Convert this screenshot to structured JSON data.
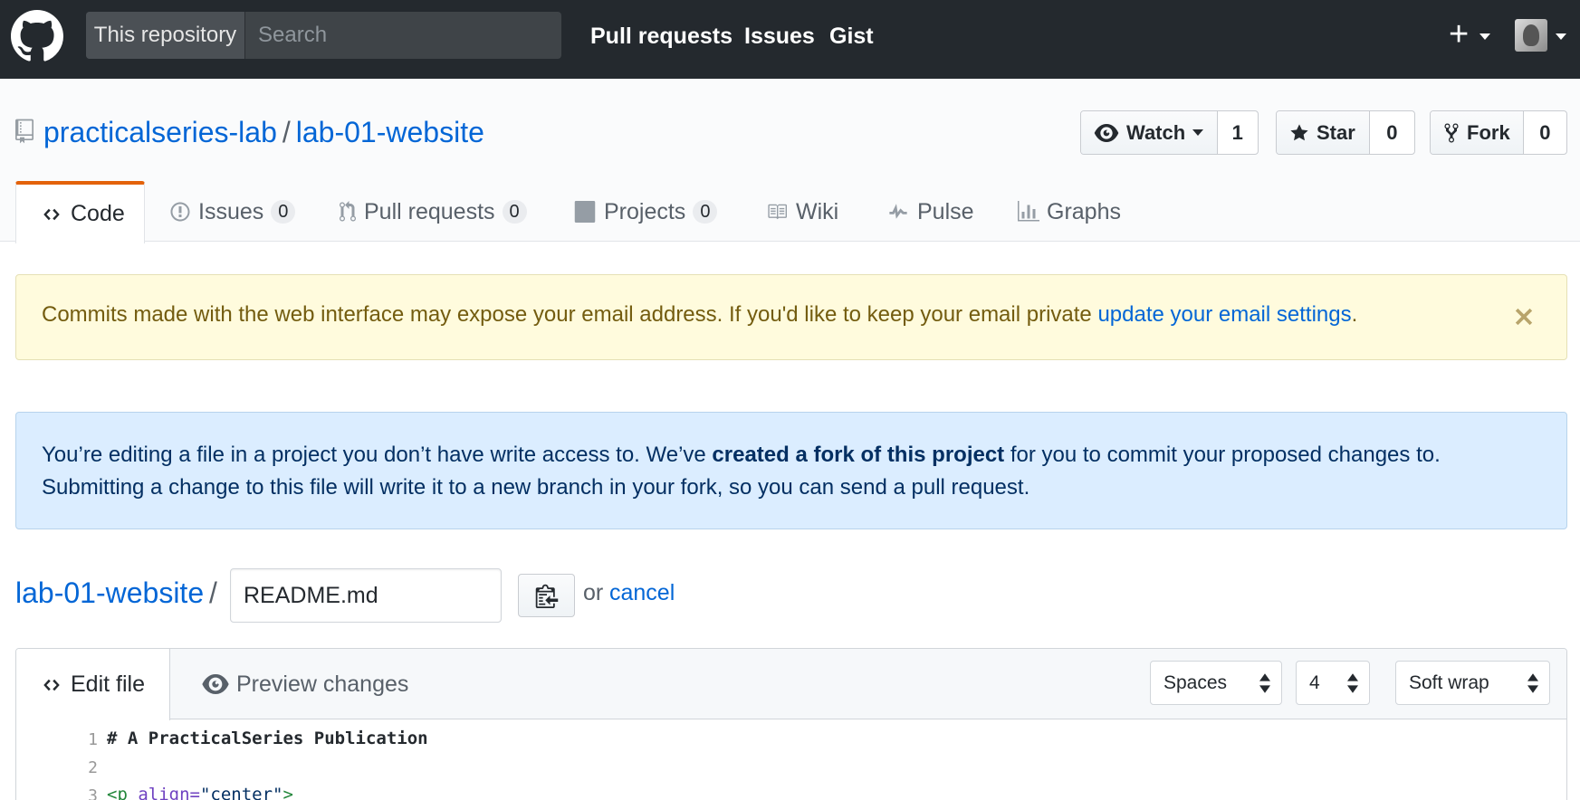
{
  "header": {
    "search_scope": "This repository",
    "search_placeholder": "Search",
    "nav": [
      "Pull requests",
      "Issues",
      "Gist"
    ],
    "plus_label": "+"
  },
  "repo": {
    "owner": "practicalseries-lab",
    "separator": "/",
    "name": "lab-01-website",
    "watch_label": "Watch",
    "watch_count": "1",
    "star_label": "Star",
    "star_count": "0",
    "fork_label": "Fork",
    "fork_count": "0"
  },
  "tabs": [
    {
      "label": "Code"
    },
    {
      "label": "Issues",
      "count": "0"
    },
    {
      "label": "Pull requests",
      "count": "0"
    },
    {
      "label": "Projects",
      "count": "0"
    },
    {
      "label": "Wiki"
    },
    {
      "label": "Pulse"
    },
    {
      "label": "Graphs"
    }
  ],
  "flash_warning": {
    "text": "Commits made with the web interface may expose your email address. If you'd like to keep your email private ",
    "link": "update your email settings",
    "end": "."
  },
  "flash_info": {
    "line1_a": "You’re editing a file in a project you don’t have write access to. We’ve ",
    "line1_bold": "created a fork of this project",
    "line1_b": " for you to commit your proposed changes to.",
    "line2": "Submitting a change to this file will write it to a new branch in your fork, so you can send a pull request."
  },
  "breadcrumb": {
    "root": "lab-01-website",
    "separator": "/",
    "filename": "README.md",
    "or_text": "or",
    "cancel": "cancel"
  },
  "editor": {
    "edit_tab": "Edit file",
    "preview_tab": "Preview changes",
    "indent_mode": "Spaces",
    "indent_size": "4",
    "wrap_mode": "Soft wrap",
    "lines": [
      {
        "num": "1",
        "text": "# A PracticalSeries Publication"
      },
      {
        "num": "2",
        "text": ""
      },
      {
        "num": "3",
        "tag_open": "<p",
        "attr": " align=",
        "str": "\"center\"",
        "tag_close": ">"
      }
    ]
  },
  "colors": {
    "header_bg": "#24292e",
    "link": "#0366d6",
    "tab_accent": "#e36209",
    "warning_bg": "#fffbdd",
    "info_bg": "#dbedff"
  }
}
